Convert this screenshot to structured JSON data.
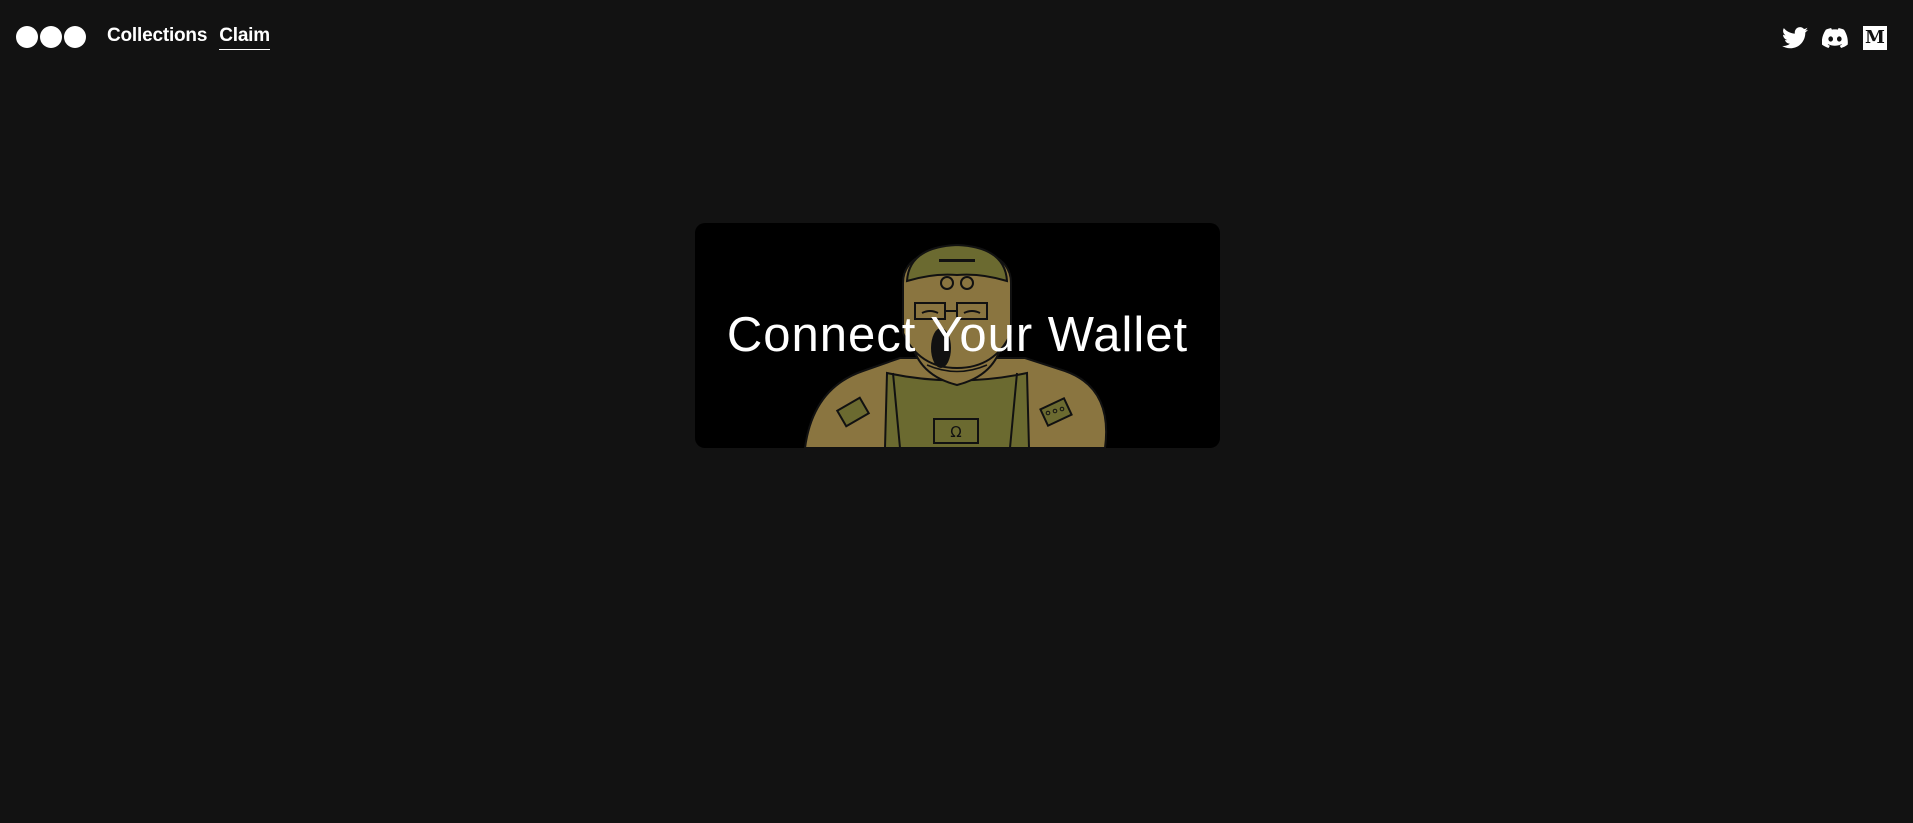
{
  "header": {
    "logo_icon": "three-dots-logo-icon",
    "nav": [
      {
        "label": "Collections",
        "active": false
      },
      {
        "label": "Claim",
        "active": true
      }
    ],
    "social": [
      {
        "icon": "twitter-icon"
      },
      {
        "icon": "discord-icon"
      },
      {
        "icon": "medium-icon",
        "glyph": "M"
      }
    ]
  },
  "main": {
    "card": {
      "title": "Connect Your Wallet",
      "illustration": "soldier-character-illustration",
      "chest_glyph": "Ω"
    }
  },
  "colors": {
    "background": "#121212",
    "card": "#000000",
    "text": "#ffffff",
    "illustration_skin": "#8a7540",
    "illustration_vest": "#6b6a30"
  }
}
